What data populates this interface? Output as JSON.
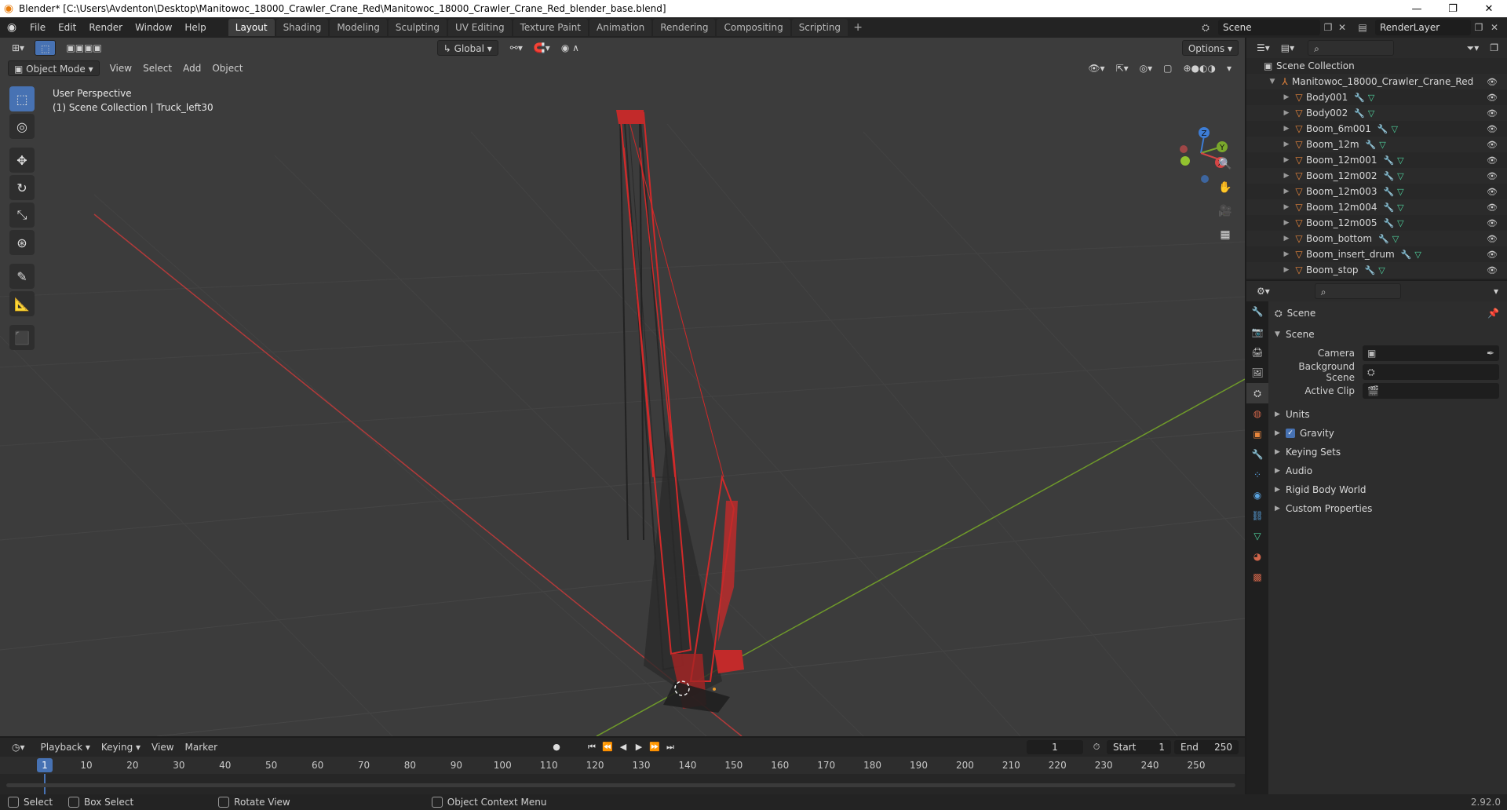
{
  "window": {
    "title": "Blender* [C:\\Users\\Avdenton\\Desktop\\Manitowoc_18000_Crawler_Crane_Red\\Manitowoc_18000_Crawler_Crane_Red_blender_base.blend]",
    "minimize": "—",
    "maximize": "❐",
    "close": "✕"
  },
  "menubar": {
    "items": [
      "File",
      "Edit",
      "Render",
      "Window",
      "Help"
    ]
  },
  "workspaces": {
    "tabs": [
      "Layout",
      "Shading",
      "Modeling",
      "Sculpting",
      "UV Editing",
      "Texture Paint",
      "Animation",
      "Rendering",
      "Compositing",
      "Scripting"
    ],
    "active": "Layout"
  },
  "scene_selector": {
    "scene": "Scene",
    "view_layer": "RenderLayer"
  },
  "viewport": {
    "mode": "Object Mode",
    "menus": [
      "View",
      "Select",
      "Add",
      "Object"
    ],
    "orientation": "Global",
    "options_label": "Options",
    "info_line1": "User Perspective",
    "info_line2": "(1) Scene Collection | Truck_left30",
    "gizmo": {
      "z": "Z",
      "y": "Y",
      "x": "X"
    }
  },
  "outliner": {
    "root": "Scene Collection",
    "collection": "Manitowoc_18000_Crawler_Crane_Red",
    "objects": [
      "Body001",
      "Body002",
      "Boom_6m001",
      "Boom_12m",
      "Boom_12m001",
      "Boom_12m002",
      "Boom_12m003",
      "Boom_12m004",
      "Boom_12m005",
      "Boom_bottom",
      "Boom_insert_drum",
      "Boom_stop"
    ]
  },
  "properties": {
    "context": "Scene",
    "panel": "Scene",
    "fields": [
      {
        "label": "Camera"
      },
      {
        "label": "Background Scene"
      },
      {
        "label": "Active Clip"
      }
    ],
    "sections": [
      "Units",
      "Gravity",
      "Keying Sets",
      "Audio",
      "Rigid Body World",
      "Custom Properties"
    ],
    "gravity_checked": true
  },
  "timeline": {
    "menus": [
      "Playback",
      "Keying",
      "View",
      "Marker"
    ],
    "current_frame": "1",
    "start_label": "Start",
    "start": "1",
    "end_label": "End",
    "end": "250",
    "ruler": [
      "1",
      "10",
      "20",
      "30",
      "40",
      "50",
      "60",
      "70",
      "80",
      "90",
      "100",
      "110",
      "120",
      "130",
      "140",
      "150",
      "160",
      "170",
      "180",
      "190",
      "200",
      "210",
      "220",
      "230",
      "240",
      "250"
    ]
  },
  "statusbar": {
    "select": "Select",
    "box_select": "Box Select",
    "rotate_view": "Rotate View",
    "context_menu": "Object Context Menu",
    "version": "2.92.0"
  },
  "colors": {
    "crane": "#d12a2a",
    "x_axis": "#c33c3c",
    "y_axis": "#7aa82c",
    "accent": "#4772b3",
    "object_icon": "#e8863c"
  }
}
